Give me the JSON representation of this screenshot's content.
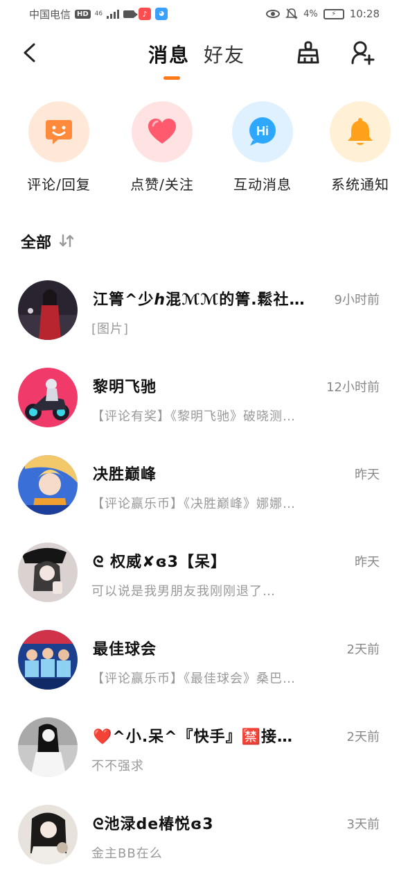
{
  "status_bar": {
    "carrier": "中国电信",
    "hd": "HD",
    "network": "46",
    "battery_percent": "4%",
    "time": "10:28"
  },
  "header": {
    "tabs": [
      {
        "label": "消息",
        "active": true
      },
      {
        "label": "好友",
        "active": false
      }
    ],
    "accent_color": "#ff7a1a"
  },
  "quick_actions": [
    {
      "label": "评论/回复",
      "icon": "comment-smile-icon",
      "bg": "#ffe8d8",
      "color": "#ff8a3c"
    },
    {
      "label": "点赞/关注",
      "icon": "heart-icon",
      "bg": "#ffe3e3",
      "color": "#ff5a6e"
    },
    {
      "label": "互动消息",
      "icon": "hi-bubble-icon",
      "bg": "#dff0ff",
      "color": "#2ea8ff"
    },
    {
      "label": "系统通知",
      "icon": "bell-icon",
      "bg": "#fff0d6",
      "color": "#ffa11a"
    }
  ],
  "section": {
    "title": "全部",
    "sort_icon": "sort-icon"
  },
  "messages": [
    {
      "name": "江箐^少ℎ混ℳℳ的箐.鬆社🌼",
      "time": "9小时前",
      "preview": "[图片]"
    },
    {
      "name": "黎明飞驰",
      "time": "12小时前",
      "preview": "【评论有奖】《黎明飞驰》破晓测…"
    },
    {
      "name": "决胜巅峰",
      "time": "昨天",
      "preview": "【评论赢乐币】《决胜巅峰》娜娜…"
    },
    {
      "name": "ᘓ 权威✘ɞ3【呆】",
      "time": "昨天",
      "preview": "可以说是我男朋友我刚刚退了…"
    },
    {
      "name": "最佳球会",
      "time": "2天前",
      "preview": "【评论赢乐币】《最佳球会》桑巴…"
    },
    {
      "name": "❤️^小.呆^『快手』🈲接…",
      "time": "2天前",
      "preview": "不不强求"
    },
    {
      "name": "ᘓ池渌de椿悦ɞ3",
      "time": "3天前",
      "preview": "金主BB在么"
    }
  ]
}
